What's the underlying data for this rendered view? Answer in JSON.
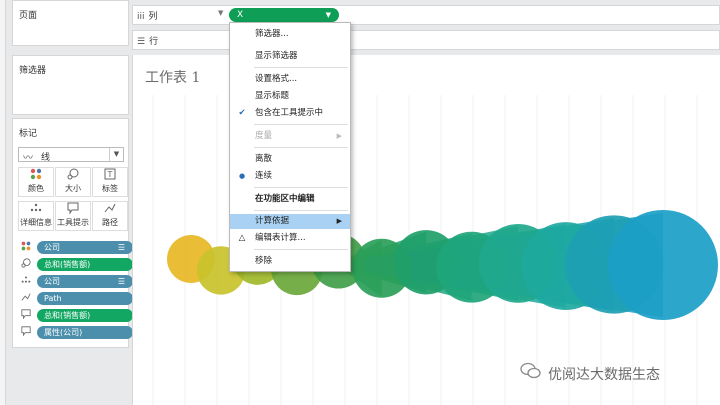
{
  "sidebar": {
    "pages_title": "页面",
    "filters_title": "筛选器",
    "marks": {
      "title": "标记",
      "mark_type": "线",
      "buttons": [
        {
          "icon": "color-dots-icon",
          "label": "颜色"
        },
        {
          "icon": "size-icon",
          "label": "大小"
        },
        {
          "icon": "label-icon",
          "label": "标签"
        },
        {
          "icon": "detail-icon",
          "label": "详细信息"
        },
        {
          "icon": "tooltip-icon",
          "label": "工具提示"
        },
        {
          "icon": "path-icon",
          "label": "路径"
        }
      ],
      "pills": [
        {
          "icon": "color-dots-icon",
          "label": "公司",
          "color": "#4b8fac",
          "sorted": true
        },
        {
          "icon": "size-icon",
          "label": "总和(销售额)",
          "color": "#12a762",
          "sorted": false
        },
        {
          "icon": "detail-icon",
          "label": "公司",
          "color": "#4b8fac",
          "sorted": true
        },
        {
          "icon": "path-icon",
          "label": "Path",
          "color": "#4b8fac",
          "sorted": false
        },
        {
          "icon": "tooltip-icon",
          "label": "总和(销售额)",
          "color": "#12a762",
          "sorted": false
        },
        {
          "icon": "tooltip-icon",
          "label": "属性(公司)",
          "color": "#4b8fac",
          "sorted": false
        }
      ]
    }
  },
  "shelves": {
    "columns_label": "列",
    "rows_label": "行",
    "columns_pill": "X"
  },
  "sheet": {
    "title": "工作表 1"
  },
  "context_menu": {
    "items": [
      {
        "label": "筛选器...",
        "bold": false,
        "disabled": false,
        "check": "",
        "submenu": false,
        "highlight": false
      },
      {
        "label": "显示筛选器",
        "bold": false,
        "disabled": false,
        "check": "",
        "submenu": false,
        "highlight": false
      },
      {
        "label": "设置格式...",
        "bold": false,
        "disabled": false,
        "check": "",
        "submenu": false,
        "highlight": false
      },
      {
        "label": "显示标题",
        "bold": false,
        "disabled": false,
        "check": "",
        "submenu": false,
        "highlight": false
      },
      {
        "label": "包含在工具提示中",
        "bold": false,
        "disabled": false,
        "check": "✔",
        "submenu": false,
        "highlight": false
      },
      {
        "label": "度量",
        "bold": false,
        "disabled": true,
        "check": "",
        "submenu": true,
        "highlight": false
      },
      {
        "label": "离散",
        "bold": false,
        "disabled": false,
        "check": "",
        "submenu": false,
        "highlight": false
      },
      {
        "label": "连续",
        "bold": false,
        "disabled": false,
        "check": "●",
        "submenu": false,
        "highlight": false
      },
      {
        "label": "在功能区中编辑",
        "bold": true,
        "disabled": false,
        "check": "",
        "submenu": false,
        "highlight": false
      },
      {
        "label": "计算依据",
        "bold": false,
        "disabled": false,
        "check": "",
        "submenu": true,
        "highlight": true
      },
      {
        "label": "编辑表计算...",
        "bold": false,
        "disabled": false,
        "check": "△",
        "submenu": false,
        "highlight": false
      },
      {
        "label": "移除",
        "bold": false,
        "disabled": false,
        "check": "",
        "submenu": false,
        "highlight": false
      }
    ]
  },
  "watermark": {
    "text": "优阅达大数据生态"
  },
  "colors": {
    "accent_green": "#0f9e55",
    "pill_blue": "#4b8fac",
    "menu_highlight": "#a8d1f3"
  },
  "viz_marks": [
    {
      "color": "#e8b726"
    },
    {
      "color": "#c9c22b"
    },
    {
      "color": "#9fb92a"
    },
    {
      "color": "#6aa83a"
    },
    {
      "color": "#3f9e48"
    },
    {
      "color": "#2a9e59"
    },
    {
      "color": "#1fa06a"
    },
    {
      "color": "#20a57b"
    },
    {
      "color": "#1fa88c"
    },
    {
      "color": "#1ea99e"
    },
    {
      "color": "#1d9fb3"
    },
    {
      "color": "#1b9ec7"
    }
  ]
}
